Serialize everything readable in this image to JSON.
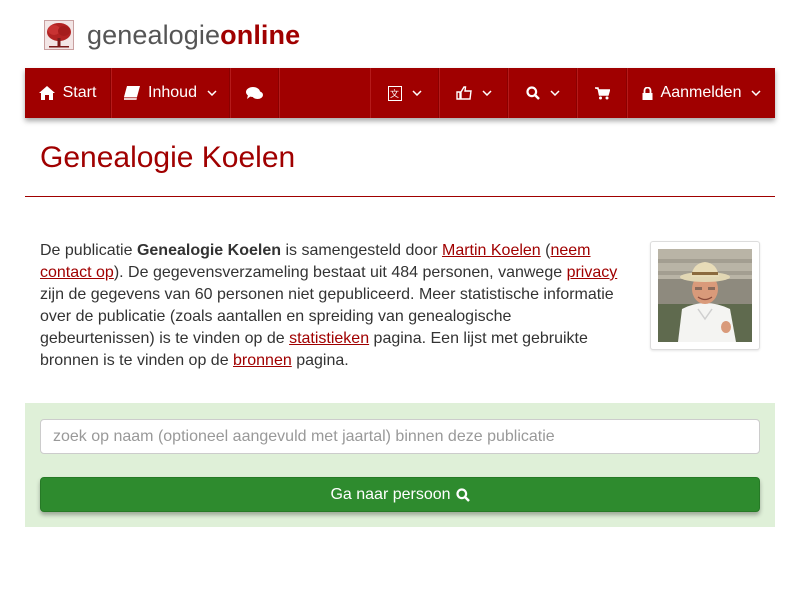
{
  "brand": {
    "name_part1": "genealogie",
    "name_part2": "online"
  },
  "nav": {
    "start_label": "Start",
    "inhoud_label": "Inhoud",
    "login_label": "Aanmelden"
  },
  "page": {
    "title": "Genealogie Koelen"
  },
  "intro": {
    "t1": "De publicatie ",
    "publication": "Genealogie Koelen",
    "t2": " is samengesteld door ",
    "author_link": "Martin Koelen",
    "t3": " (",
    "contact_link": "neem contact op",
    "t4": "). De gegevensverzameling bestaat uit 484 personen, vanwege ",
    "privacy_link": "privacy",
    "t5": " zijn de gegevens van 60 personen niet gepubliceerd. Meer statistische informatie over de publicatie (zoals aantallen en spreiding van genealogische gebeurtenissen) is te vinden op de ",
    "stats_link": "statistieken",
    "t6": " pagina. Een lijst met gebruikte bronnen is te vinden op de ",
    "sources_link": "bronnen",
    "t7": " pagina."
  },
  "search": {
    "placeholder": "zoek op naam (optioneel aangevuld met jaartal) binnen deze publicatie",
    "button_label": "Ga naar persoon"
  },
  "colors": {
    "brand": "#a00000",
    "panel": "#dff0d8",
    "button": "#2e8b2e"
  }
}
